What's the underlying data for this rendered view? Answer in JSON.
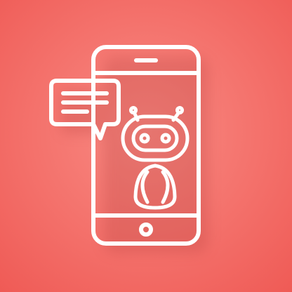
{
  "icon": {
    "name": "chatbot-smartphone-icon",
    "parts": [
      "smartphone-icon",
      "chat-bubble-icon",
      "robot-icon"
    ]
  },
  "colors": {
    "background_center": "#f98b84",
    "background_edge": "#ef5a55",
    "stroke": "#ffffff",
    "shadow": "#b8403c"
  }
}
